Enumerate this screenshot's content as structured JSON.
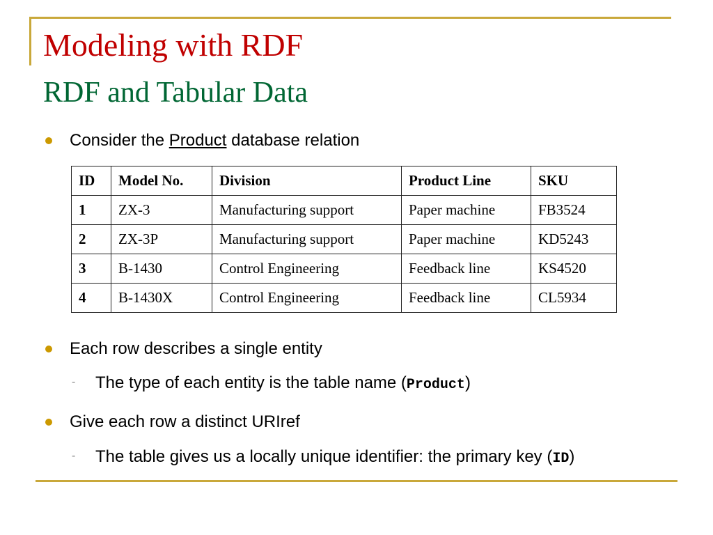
{
  "slide": {
    "title": "Modeling with RDF",
    "subtitle": "RDF and Tabular Data",
    "accent_color": "#c9a83a",
    "title_color": "#c00000",
    "subtitle_color": "#006633",
    "bullets": [
      {
        "prefix": "Consider the ",
        "link": "Product",
        "suffix": " database relation"
      },
      {
        "text": "Each row describes a single entity",
        "sub": {
          "prefix": "The type of each entity is the table name (",
          "code": "Product",
          "suffix": ")"
        }
      },
      {
        "text": "Give each row a distinct URIref",
        "sub": {
          "prefix": "The table gives us a locally unique identifier: the primary key (",
          "code": "ID",
          "suffix": ")"
        }
      }
    ],
    "table": {
      "headers": [
        "ID",
        "Model No.",
        "Division",
        "Product Line",
        "SKU"
      ],
      "rows": [
        [
          "1",
          "ZX-3",
          "Manufacturing support",
          "Paper machine",
          "FB3524"
        ],
        [
          "2",
          "ZX-3P",
          "Manufacturing support",
          "Paper machine",
          "KD5243"
        ],
        [
          "3",
          "B-1430",
          "Control Engineering",
          "Feedback line",
          "KS4520"
        ],
        [
          "4",
          "B-1430X",
          "Control Engineering",
          "Feedback line",
          "CL5934"
        ]
      ]
    }
  }
}
